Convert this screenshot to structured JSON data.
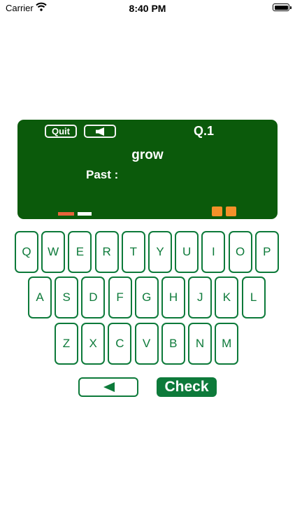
{
  "status_bar": {
    "carrier": "Carrier",
    "time": "8:40 PM"
  },
  "board": {
    "quit_label": "Quit",
    "sound_icon": "speaker-icon",
    "question_number": "Q.1",
    "word": "grow",
    "prompt_label": "Past :",
    "answer": "",
    "colors": {
      "board": "#0b5a0b",
      "progress_current": "#e8643c",
      "progress_remaining": "#ffffff",
      "score_mark": "#f39129"
    }
  },
  "keyboard": {
    "rows": [
      [
        "Q",
        "W",
        "E",
        "R",
        "T",
        "Y",
        "U",
        "I",
        "O",
        "P"
      ],
      [
        "A",
        "S",
        "D",
        "F",
        "G",
        "H",
        "J",
        "K",
        "L"
      ],
      [
        "Z",
        "X",
        "C",
        "V",
        "B",
        "N",
        "M"
      ]
    ],
    "key_color": "#0d7a3a"
  },
  "controls": {
    "back_icon": "triangle-left-icon",
    "check_label": "Check"
  }
}
